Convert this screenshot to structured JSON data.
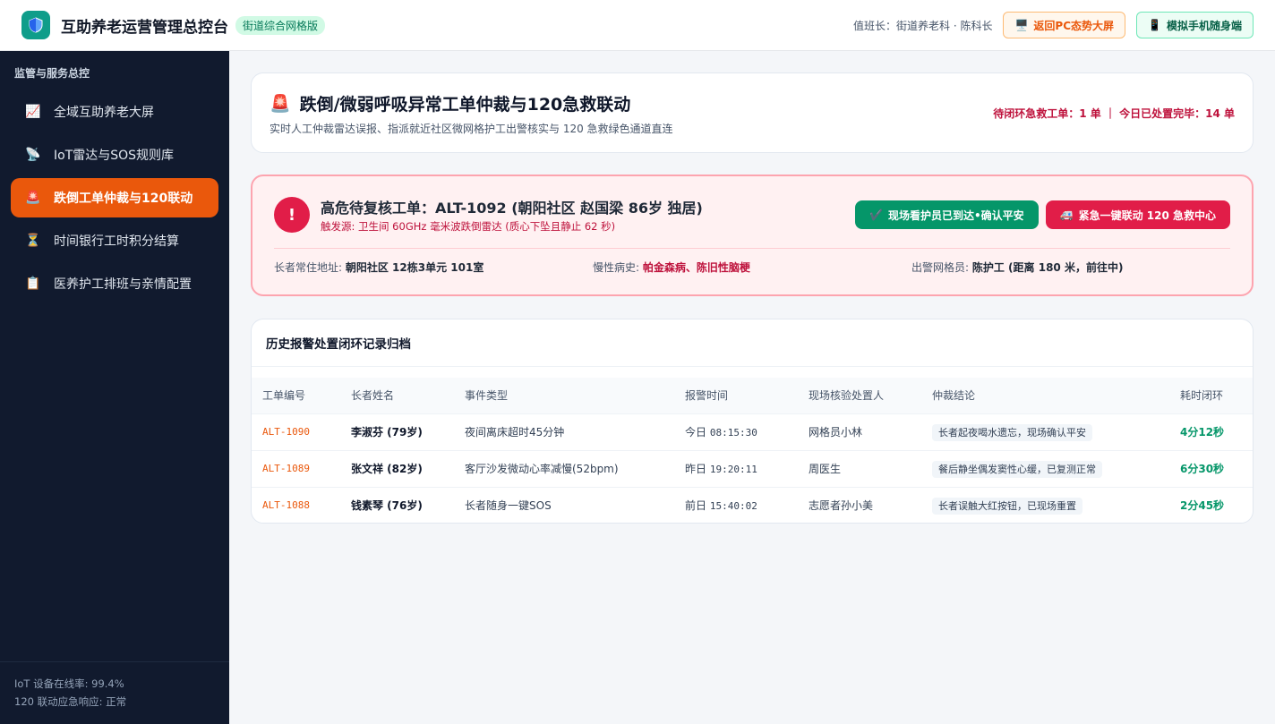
{
  "header": {
    "app_title": "互助养老运营管理总控台",
    "edition_badge": "街道综合网格版",
    "duty_text": "值班长：街道养老科 · 陈科长",
    "back_pc_label": "返回PC态势大屏",
    "mobile_label": "模拟手机随身端"
  },
  "sidebar": {
    "title": "监管与服务总控",
    "items": [
      {
        "label": "全域互助养老大屏",
        "icon": "chart-icon",
        "glyph": "📈"
      },
      {
        "label": "IoT雷达与SOS规则库",
        "icon": "satellite-icon",
        "glyph": "📡"
      },
      {
        "label": "跌倒工单仲裁与120联动",
        "icon": "siren-icon",
        "glyph": "🚨",
        "active": true
      },
      {
        "label": "时间银行工时积分结算",
        "icon": "hourglass-icon",
        "glyph": "⏳"
      },
      {
        "label": "医养护工排班与亲情配置",
        "icon": "clipboard-icon",
        "glyph": "📋"
      }
    ],
    "footer_line1": "IoT 设备在线率: 99.4%",
    "footer_line2": "120 联动应急响应: 正常"
  },
  "page": {
    "title": "跌倒/微弱呼吸异常工单仲裁与120急救联动",
    "subtitle": "实时人工仲裁雷达误报、指派就近社区微网格护工出警核实与 120 急救绿色通道直连",
    "stats": "待闭环急救工单：1 单 ｜ 今日已处置完毕：14 单"
  },
  "alert": {
    "title": "高危待复核工单：ALT-1092 (朝阳社区 赵国梁 86岁 独居)",
    "source": "触发源: 卫生间 60GHz 毫米波跌倒雷达 (质心下坠且静止 62 秒)",
    "safe_label": "现场看护员已到达•确认平安",
    "emergency_label": "紧急一键联动 120 急救中心",
    "address_label": "长者常住地址:",
    "address_value": "朝阳社区 12栋3单元 101室",
    "disease_label": "慢性病史:",
    "disease_value": "帕金森病、陈旧性脑梗",
    "staff_label": "出警网格员:",
    "staff_value": "陈护工 (距离 180 米，前往中)"
  },
  "history": {
    "title": "历史报警处置闭环记录归档",
    "columns": [
      "工单编号",
      "长者姓名",
      "事件类型",
      "报警时间",
      "现场核验处置人",
      "仲裁结论",
      "耗时闭环"
    ],
    "rows": [
      {
        "id": "ALT-1090",
        "name": "李淑芬 (79岁)",
        "event": "夜间离床超时45分钟",
        "day": "今日",
        "time": "08:15:30",
        "handler": "网格员小林",
        "verdict": "长者起夜喝水遗忘，现场确认平安",
        "duration": "4分12秒"
      },
      {
        "id": "ALT-1089",
        "name": "张文祥 (82岁)",
        "event": "客厅沙发微动心率减慢(52bpm)",
        "day": "昨日",
        "time": "19:20:11",
        "handler": "周医生",
        "verdict": "餐后静坐偶发窦性心缓，已复测正常",
        "duration": "6分30秒"
      },
      {
        "id": "ALT-1088",
        "name": "钱素琴 (76岁)",
        "event": "长者随身一键SOS",
        "day": "前日",
        "time": "15:40:02",
        "handler": "志愿者孙小美",
        "verdict": "长者误触大红按钮，已现场重置",
        "duration": "2分45秒"
      }
    ]
  }
}
